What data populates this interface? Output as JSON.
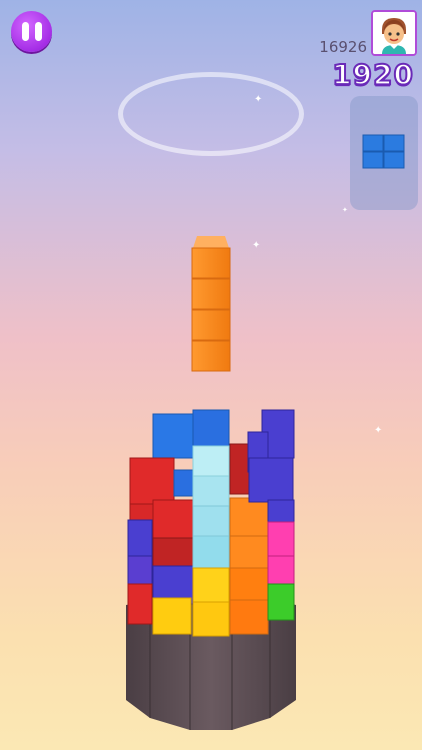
{
  "hud": {
    "best_score": "16926",
    "score": "1920",
    "pause_icon": "pause-icon",
    "avatar_icon": "boy-avatar-icon"
  },
  "next_piece": {
    "shape": "2x2 square",
    "color": "#2b7be0"
  },
  "falling_piece": {
    "shape": "I (vertical, 4 blocks)",
    "color": "#ff8a1f"
  },
  "colors": {
    "red": "#e02a2a",
    "blue": "#2a6fe0",
    "indigo": "#4a3fd0",
    "orange": "#ff8a1f",
    "yellow": "#ffd21a",
    "magenta": "#ff3fb0",
    "green": "#3ccc2a",
    "cyan_ghost": "#9fe6f0",
    "tower_base": "#5c4c52"
  }
}
